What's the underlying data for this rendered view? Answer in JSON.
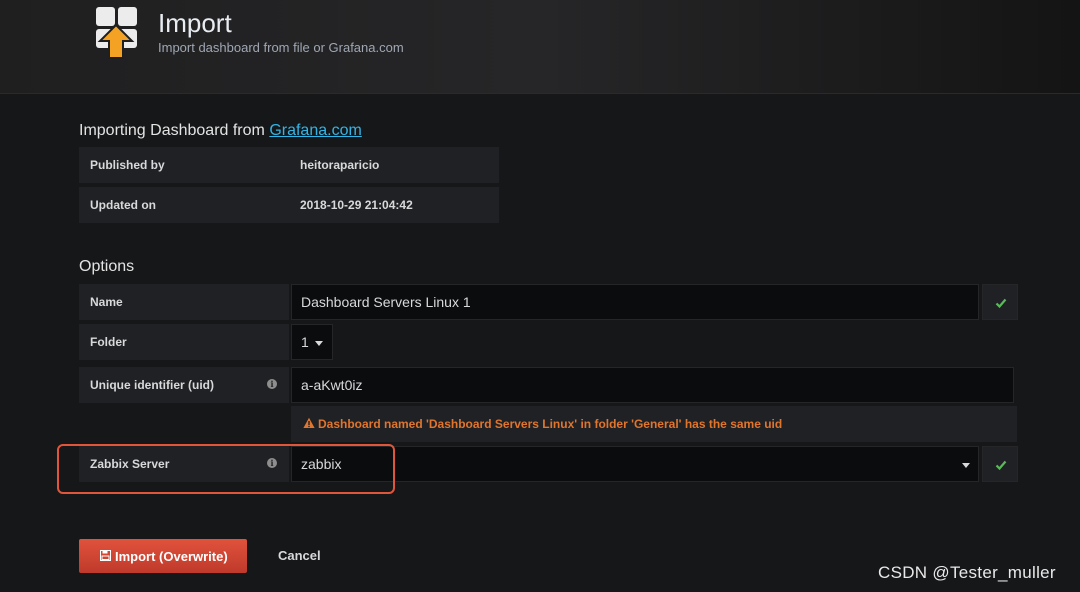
{
  "header": {
    "title": "Import",
    "subtitle": "Import dashboard from file or Grafana.com",
    "icon": "import-dashboard-icon"
  },
  "source": {
    "prefix": "Importing Dashboard from ",
    "link_text": "Grafana.com",
    "rows": [
      {
        "label": "Published by",
        "value": "heitoraparicio"
      },
      {
        "label": "Updated on",
        "value": "2018-10-29 21:04:42"
      }
    ]
  },
  "options": {
    "title": "Options",
    "name": {
      "label": "Name",
      "value": "Dashboard  Servers  Linux 1"
    },
    "folder": {
      "label": "Folder",
      "value": "1"
    },
    "uid": {
      "label": "Unique identifier (uid)",
      "value": "a-aKwt0iz"
    },
    "warning": "Dashboard named 'Dashboard Servers Linux' in folder 'General' has the same uid",
    "zabbix": {
      "label": "Zabbix Server",
      "value": "zabbix"
    }
  },
  "actions": {
    "import_label": "Import (Overwrite)",
    "cancel_label": "Cancel"
  },
  "watermark": "CSDN @Tester_muller",
  "colors": {
    "background": "#161719",
    "link": "#33b5e5",
    "warning": "#e0752d",
    "success": "#5cb85c",
    "danger": "#e0523c",
    "highlight_border": "#e0563a"
  }
}
